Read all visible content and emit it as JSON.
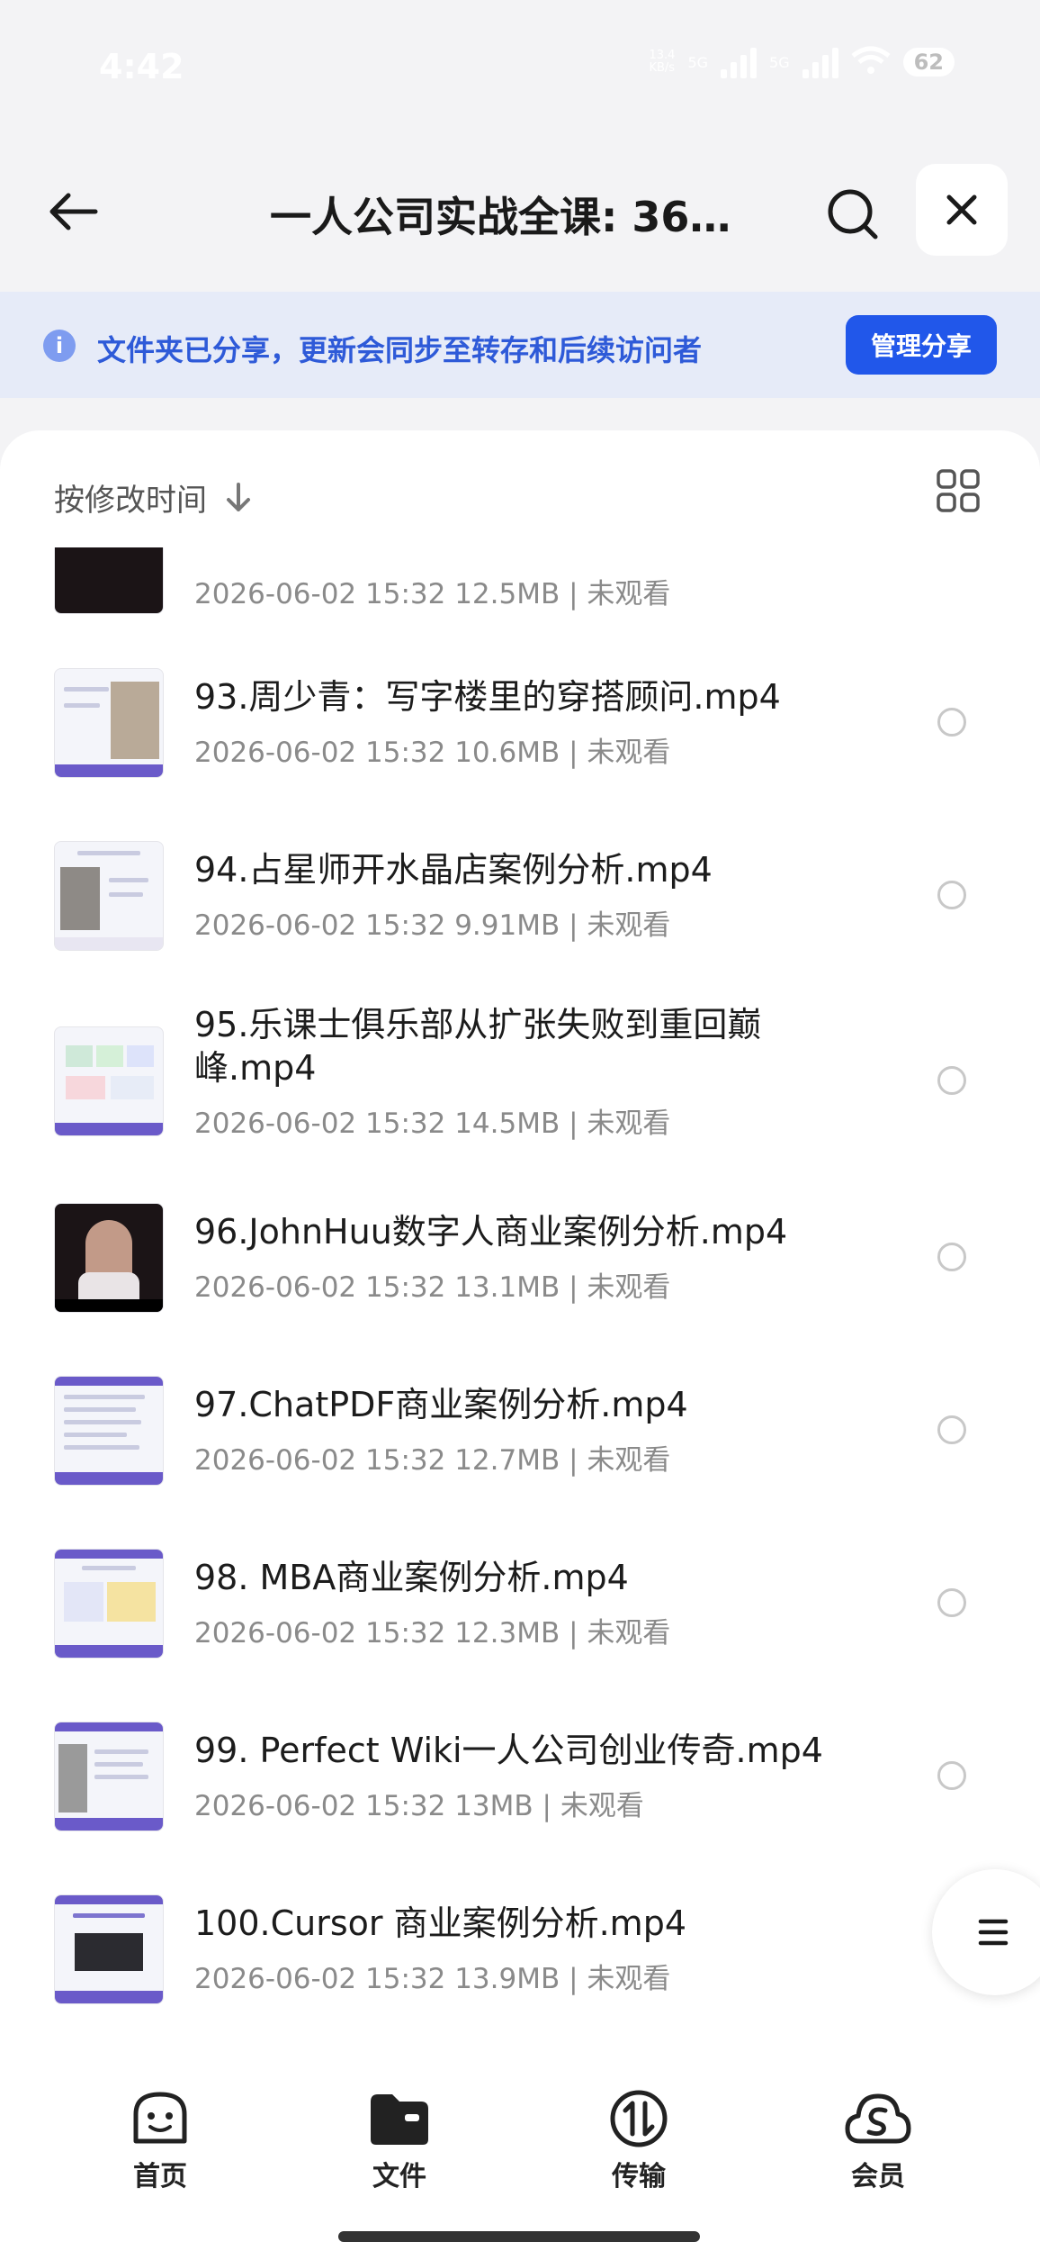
{
  "status": {
    "time": "4:42",
    "network_small": "13.4\nKB/s",
    "net1": "5G",
    "net2": "5G",
    "battery": "62"
  },
  "header": {
    "title": "一人公司实战全课: 36…"
  },
  "banner": {
    "text": "文件夹已分享，更新会同步至转存和后续访问者",
    "button": "管理分享"
  },
  "sort": {
    "label": "按修改时间"
  },
  "files": [
    {
      "name": "",
      "meta": "2026-06-02 15:32  12.5MB | 未观看"
    },
    {
      "name": "93.周少青：写字楼里的穿搭顾问.mp4",
      "meta": "2026-06-02 15:32  10.6MB | 未观看"
    },
    {
      "name": "94.占星师开水晶店案例分析.mp4",
      "meta": "2026-06-02 15:32  9.91MB | 未观看"
    },
    {
      "name": "95.乐课士俱乐部从扩张失败到重回巅峰.mp4",
      "meta": "2026-06-02 15:32  14.5MB | 未观看"
    },
    {
      "name": "96.JohnHuu数字人商业案例分析.mp4",
      "meta": "2026-06-02 15:32  13.1MB | 未观看"
    },
    {
      "name": "97.ChatPDF商业案例分析.mp4",
      "meta": "2026-06-02 15:32  12.7MB | 未观看"
    },
    {
      "name": "98. MBA商业案例分析.mp4",
      "meta": "2026-06-02 15:32  12.3MB | 未观看"
    },
    {
      "name": "99. Perfect Wiki一人公司创业传奇.mp4",
      "meta": "2026-06-02 15:32  13MB | 未观看"
    },
    {
      "name": "100.Cursor 商业案例分析.mp4",
      "meta": "2026-06-02 15:32  13.9MB | 未观看"
    }
  ],
  "tabs": [
    {
      "label": "首页",
      "icon": "smiley-icon"
    },
    {
      "label": "文件",
      "icon": "folder-icon"
    },
    {
      "label": "传输",
      "icon": "transfer-icon"
    },
    {
      "label": "会员",
      "icon": "member-cloud-icon"
    }
  ],
  "colors": {
    "accent": "#2157ea",
    "banner_bg": "#e6ebf8",
    "banner_text": "#2e5ad8"
  }
}
